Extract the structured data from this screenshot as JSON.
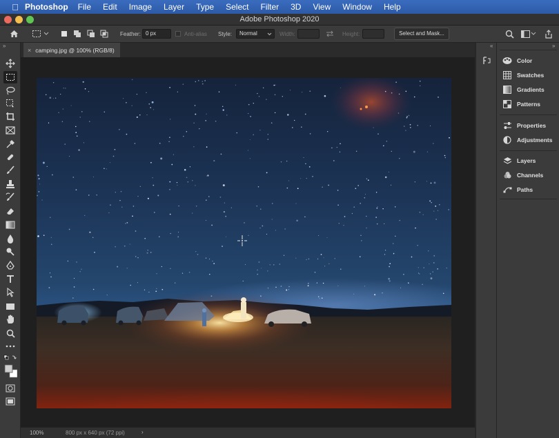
{
  "menubar": {
    "app_name": "Photoshop",
    "items": [
      "File",
      "Edit",
      "Image",
      "Layer",
      "Type",
      "Select",
      "Filter",
      "3D",
      "View",
      "Window",
      "Help"
    ]
  },
  "window": {
    "title": "Adobe Photoshop 2020"
  },
  "options": {
    "feather_label": "Feather:",
    "feather_value": "0 px",
    "antialias_label": "Anti-alias",
    "style_label": "Style:",
    "style_value": "Normal",
    "width_label": "Width:",
    "height_label": "Height:",
    "select_mask_label": "Select and Mask..."
  },
  "document": {
    "tab_label": "camping.jpg @ 100% (RGB/8)"
  },
  "status": {
    "zoom": "100%",
    "doc_info": "800 px x 640 px (72 ppi)"
  },
  "panels": {
    "group1": [
      "Color",
      "Swatches",
      "Gradients",
      "Patterns"
    ],
    "group2": [
      "Properties",
      "Adjustments"
    ],
    "group3": [
      "Layers",
      "Channels",
      "Paths"
    ]
  },
  "colors": {
    "accent": "#2d5aa6",
    "ui_bg": "#3b3b3b",
    "canvas_bg": "#1f1f1f"
  }
}
